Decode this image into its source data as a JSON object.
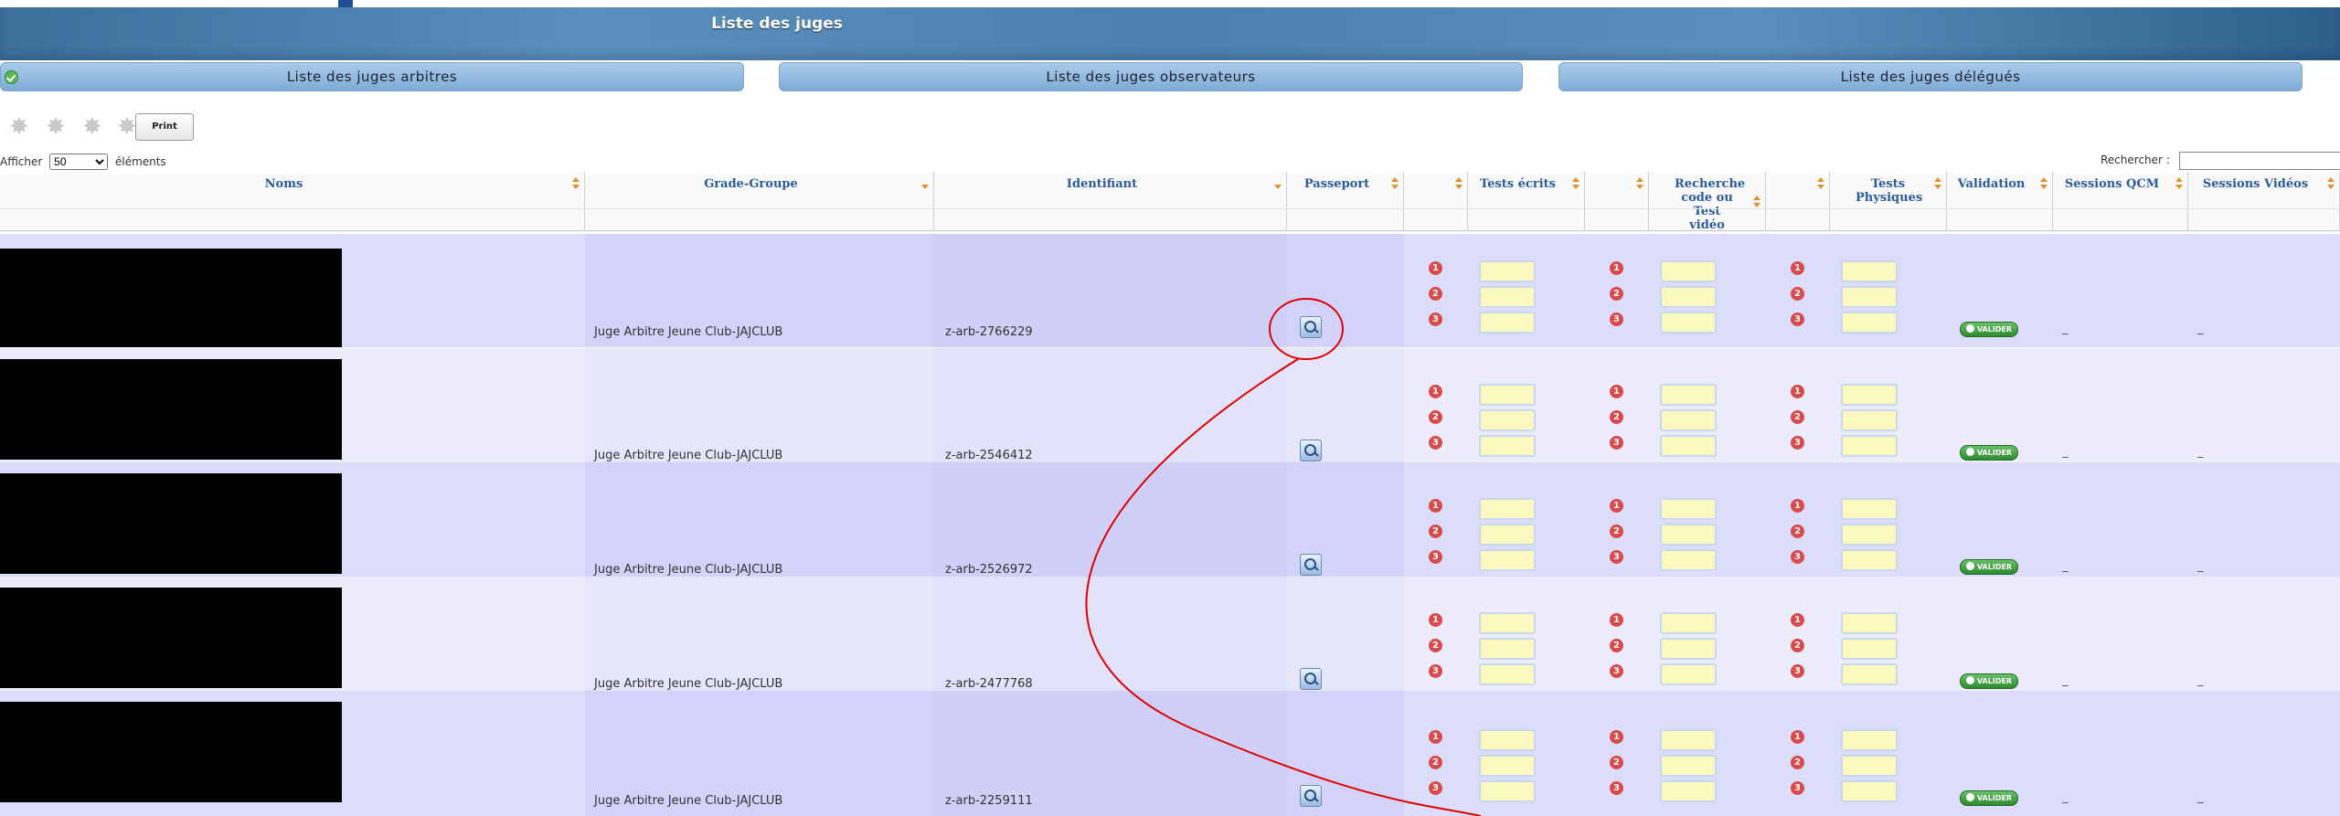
{
  "header": {
    "title": "Liste des juges"
  },
  "tabs": [
    {
      "label": "Liste des juges arbitres",
      "active": true
    },
    {
      "label": "Liste des juges observateurs",
      "active": false
    },
    {
      "label": "Liste des juges délégués",
      "active": false
    }
  ],
  "toolbar": {
    "print_label": "Print",
    "tool_icons": [
      "puzzle-icon",
      "puzzle-icon",
      "puzzle-icon",
      "puzzle-icon"
    ]
  },
  "length": {
    "prefix": "Afficher",
    "value": "50",
    "suffix": "éléments"
  },
  "search": {
    "label": "Rechercher :",
    "value": ""
  },
  "columns": [
    {
      "key": "noms",
      "label": "Noms"
    },
    {
      "key": "grade",
      "label": "Grade-Groupe"
    },
    {
      "key": "identifiant",
      "label": "Identifiant"
    },
    {
      "key": "passeport",
      "label": "Passeport"
    },
    {
      "key": "blank1",
      "label": ""
    },
    {
      "key": "tests_ecrits",
      "label": "Tests écrits"
    },
    {
      "key": "blank2",
      "label": ""
    },
    {
      "key": "recherche",
      "label": "Recherche code ou Test vidéo"
    },
    {
      "key": "blank3",
      "label": ""
    },
    {
      "key": "tests_physiques",
      "label": "Tests Physiques"
    },
    {
      "key": "validation",
      "label": "Validation"
    },
    {
      "key": "sessions_qcm",
      "label": "Sessions QCM"
    },
    {
      "key": "sessions_videos",
      "label": "Sessions Vidéos"
    }
  ],
  "rows": [
    {
      "grade": "Juge Arbitre Jeune Club-JAJCLUB",
      "identifiant": "z-arb-2766229",
      "qcm": "_",
      "videos": "_"
    },
    {
      "grade": "Juge Arbitre Jeune Club-JAJCLUB",
      "identifiant": "z-arb-2546412",
      "qcm": "_",
      "videos": "_"
    },
    {
      "grade": "Juge Arbitre Jeune Club-JAJCLUB",
      "identifiant": "z-arb-2526972",
      "qcm": "_",
      "videos": "_"
    },
    {
      "grade": "Juge Arbitre Jeune Club-JAJCLUB",
      "identifiant": "z-arb-2477768",
      "qcm": "_",
      "videos": "_"
    },
    {
      "grade": "Juge Arbitre Jeune Club-JAJCLUB",
      "identifiant": "z-arb-2259111",
      "qcm": "_",
      "videos": "_"
    }
  ],
  "attempt_numbers": [
    "1",
    "2",
    "3"
  ],
  "validation_badge": "VALIDER",
  "colors": {
    "title_bar": "#4c80b0",
    "tab": "#8fb9df",
    "header_text": "#2c5aa0",
    "sort_arrow": "#e0902a",
    "row_odd": "#dcdcfb",
    "row_even": "#ececfc",
    "input_fill": "#fbf8c0",
    "annotation": "#e00000"
  }
}
